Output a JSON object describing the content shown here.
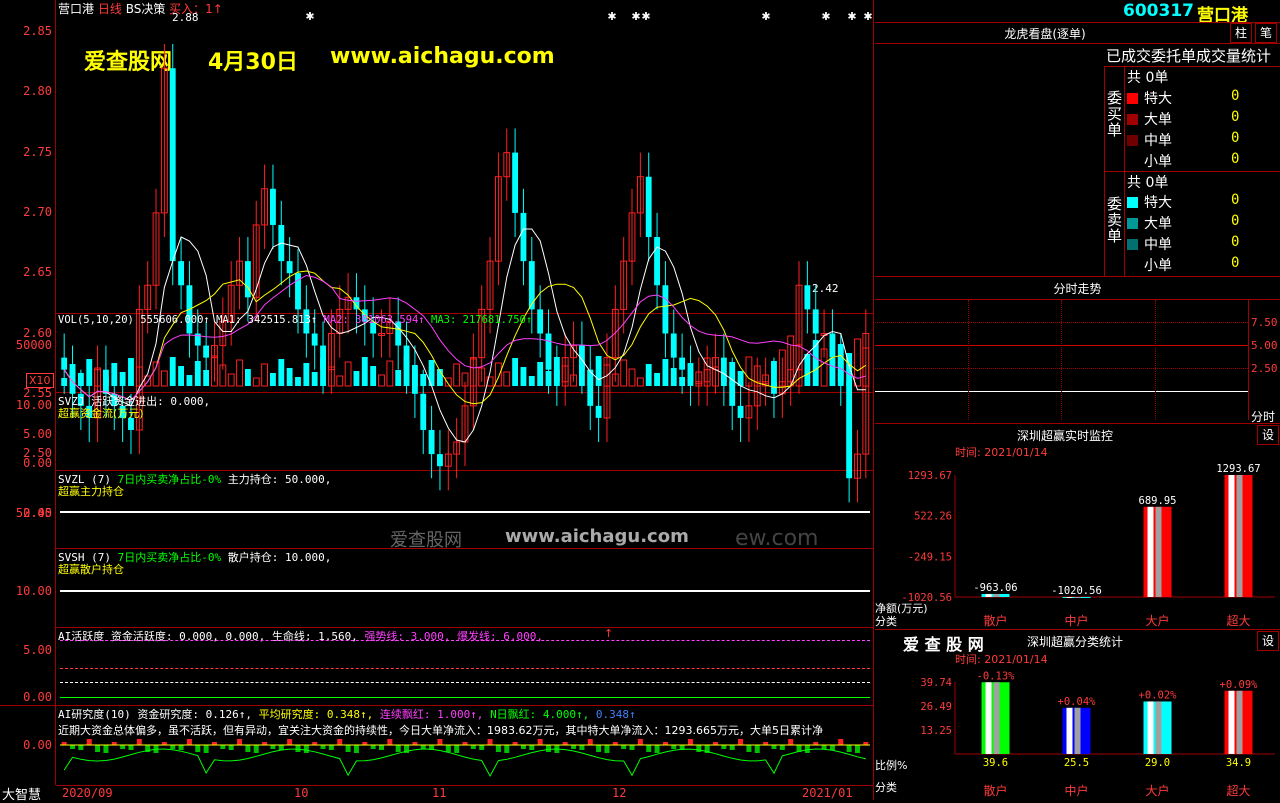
{
  "header": {
    "stock": "营口港",
    "period": "日线",
    "indicator": "BS决策",
    "signal": "买入：1↑",
    "high_mark": "2.88",
    "low_mark": "2.42"
  },
  "watermark": {
    "site": "爱查股网",
    "date": "4月30日",
    "url": "www.aichagu.com",
    "mid_site": "爱查股网",
    "mid_url": "www.aichagu.com",
    "mid_faded": "ew.com"
  },
  "price_axis": [
    "2.85",
    "2.80",
    "2.75",
    "2.70",
    "2.65",
    "2.60",
    "2.55",
    "2.50",
    "2.45"
  ],
  "vol": {
    "label": "VOL(5,10,20)",
    "value": "555606.000↑",
    "ma1": "MA1: 342515.813↑",
    "ma2": "MA2: 301063.594↑",
    "ma3": "MA3: 217681.750↑",
    "axis": "50000",
    "unit": "X10"
  },
  "svzj": {
    "label": "SVZJ  活跃资金进出: 0.000,",
    "sub": "超赢资金流(万元)",
    "axis": [
      "10.00",
      "5.00",
      "0.00"
    ]
  },
  "svzl": {
    "label1": "SVZL (7)",
    "label2": "7日内买卖净占比-0%",
    "label3": "主力持仓: 50.000,",
    "sub": "超赢主力持仓",
    "axis": "50.00"
  },
  "svsh": {
    "label1": "SVSH (7)",
    "label2": "7日内买卖净占比-0%",
    "label3": "散户持仓: 10.000,",
    "sub": "超赢散户持仓",
    "axis": "10.00"
  },
  "ai1": {
    "label": "AI活跃度  资金活跃度: 0.000, 0.000, 生命线: 1.560,",
    "strong": "强势线: 3.000,",
    "burst": "爆发线: 6.000,",
    "arrow": "↑",
    "axis": [
      "5.00",
      "0.00"
    ]
  },
  "ai2": {
    "label": "AI研究度(10)  资金研究度: 0.126↑,",
    "avg": "平均研究度: 0.348↑,",
    "red_days": "连续飘红: 1.000↑,",
    "n_red": "N日飘红: 4.000↑,",
    "tail": "0.348↑",
    "note": "近期大资金总体偏多，虽不活跃，但有异动，宜关注大资金的持续性，今日大单净流入：1983.62万元，其中特大单净流入：1293.665万元，大单5日累计净",
    "axis": "0.00"
  },
  "x_axis": {
    "labels": [
      "2020/09",
      "10",
      "11",
      "12",
      "2021/01"
    ]
  },
  "corner_label": "大智慧",
  "right": {
    "code": "600317",
    "name": "营口港",
    "btn_zhu": "柱",
    "btn_bi": "笔",
    "panel_title": "龙虎看盘(逐单)",
    "stats_title": "已成交委托单成交量统计",
    "buy_side": "委买单",
    "sell_side": "委卖单",
    "buy": {
      "total_label": "共",
      "total": "0单",
      "rows": [
        {
          "label": "特大",
          "value": "0",
          "color": "#ff0000"
        },
        {
          "label": "大单",
          "value": "0",
          "color": "#a00000"
        },
        {
          "label": "中单",
          "value": "0",
          "color": "#700000"
        },
        {
          "label": "小单",
          "value": "0",
          "color": "#000000"
        }
      ]
    },
    "sell": {
      "total_label": "共",
      "total": "0单",
      "rows": [
        {
          "label": "特大",
          "value": "0",
          "color": "#00ffff"
        },
        {
          "label": "大单",
          "value": "0",
          "color": "#009999"
        },
        {
          "label": "中单",
          "value": "0",
          "color": "#007070"
        },
        {
          "label": "小单",
          "value": "0",
          "color": "#000000"
        }
      ]
    },
    "intraday": {
      "title": "分时走势",
      "axis": [
        "7.50",
        "5.00",
        "2.50"
      ],
      "footer": "分时"
    },
    "monitor": {
      "title": "深圳超赢实时监控",
      "btn": "设",
      "time": "时间: 2021/01/14",
      "ylabel": "净额(万元)",
      "xlabel": "分类",
      "y_axis": [
        "1293.67",
        "522.26",
        "-249.15",
        "-1020.56"
      ]
    },
    "category": {
      "title": "深圳超赢分类统计",
      "btn": "设",
      "time": "时间: 2021/01/14",
      "brand": "爱 查 股 网",
      "ylabel": "比例%",
      "xlabel": "分类",
      "y_axis": [
        "39.74",
        "26.49",
        "13.25"
      ]
    }
  },
  "chart_data": [
    {
      "type": "bar",
      "title": "深圳超赢实时监控",
      "ylabel": "净额(万元)",
      "xlabel": "分类",
      "categories": [
        "散户",
        "中户",
        "大户",
        "超大"
      ],
      "values": [
        -963.06,
        -1020.56,
        689.95,
        1293.67
      ],
      "value_labels": [
        "-963.06",
        "-1020.56",
        "689.95",
        "1293.67"
      ],
      "ylim": [
        -1020.56,
        1293.67
      ],
      "colors": [
        "#00ffff",
        "#00ffff",
        "#ff0000",
        "#ff0000"
      ]
    },
    {
      "type": "bar",
      "title": "深圳超赢分类统计",
      "ylabel": "比例%",
      "xlabel": "分类",
      "categories": [
        "散户",
        "中户",
        "大户",
        "超大"
      ],
      "values": [
        39.6,
        25.5,
        29.0,
        34.9
      ],
      "value_labels": [
        "39.6",
        "25.5",
        "29.0",
        "34.9"
      ],
      "change_labels": [
        "-0.13%",
        "+0.04%",
        "+0.02%",
        "+0.09%"
      ],
      "ylim": [
        0,
        39.74
      ],
      "colors": [
        "#00ff00",
        "#0000ff",
        "#00ffff",
        "#ff0000"
      ]
    }
  ]
}
